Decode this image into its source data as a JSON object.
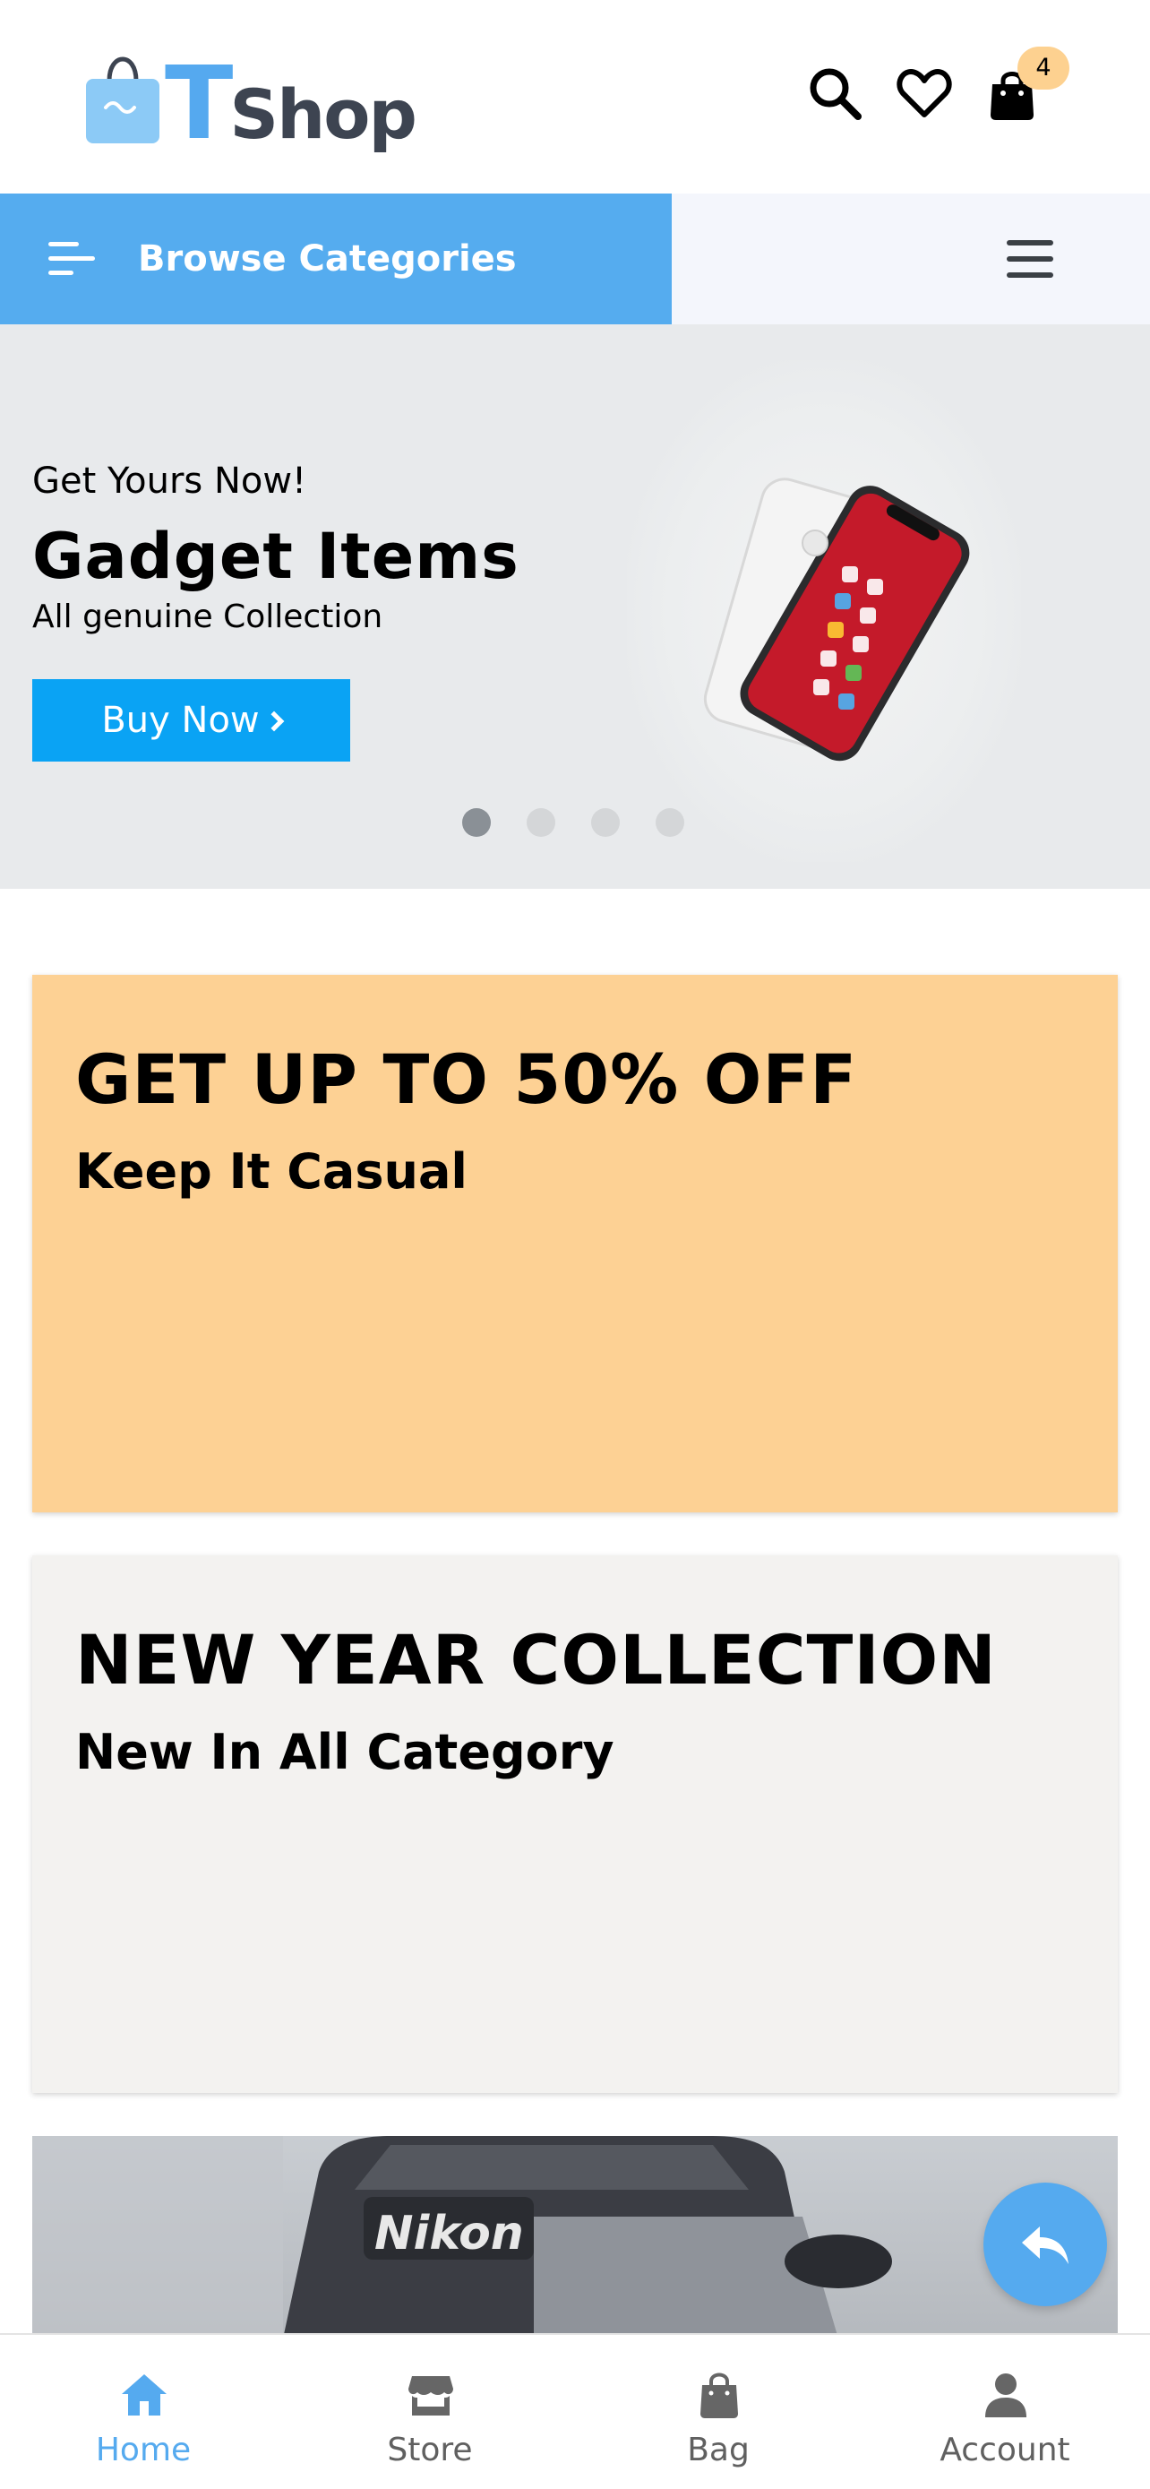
{
  "header": {
    "logo_t": "T",
    "logo_shop": "Shop",
    "cart_count": "4"
  },
  "category_bar": {
    "browse_label": "Browse Categories"
  },
  "hero": {
    "eyebrow": "Get Yours Now!",
    "title": "Gadget Items",
    "subtitle": "All genuine Collection",
    "button_label": "Buy Now",
    "slide_count": 4,
    "active_slide": 1
  },
  "promos": [
    {
      "title": "GET UP TO 50% OFF",
      "subtitle": "Keep It Casual"
    },
    {
      "title": "NEW YEAR COLLECTION",
      "subtitle": "New In All Category"
    }
  ],
  "camera_banner": {
    "brand": "Nikon"
  },
  "bottom_nav": {
    "items": [
      {
        "label": "Home",
        "icon": "home-icon",
        "active": true
      },
      {
        "label": "Store",
        "icon": "store-icon",
        "active": false
      },
      {
        "label": "Bag",
        "icon": "bag-icon",
        "active": false
      },
      {
        "label": "Account",
        "icon": "account-icon",
        "active": false
      }
    ]
  },
  "colors": {
    "accent": "#55acef",
    "button_blue": "#0aa3f4",
    "promo_orange": "#fdd194",
    "promo_grey": "#f3f2f0",
    "badge": "#fdd190"
  }
}
